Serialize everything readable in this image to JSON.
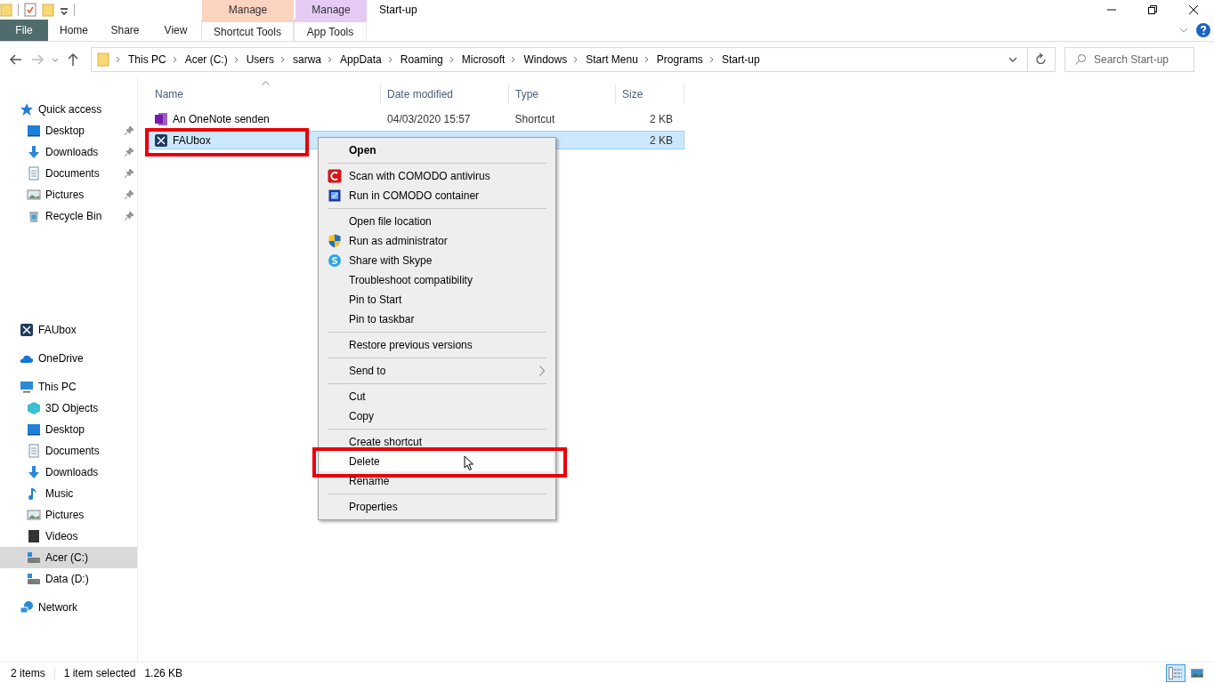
{
  "title_bar": {
    "context_groups": [
      {
        "label": "Manage",
        "color": "#fcd3bf"
      },
      {
        "label": "Manage",
        "color": "#e6cbf5"
      }
    ],
    "title": "Start-up"
  },
  "ribbon": {
    "tabs": [
      {
        "label": "File",
        "kind": "file"
      },
      {
        "label": "Home",
        "kind": "tab"
      },
      {
        "label": "Share",
        "kind": "tab"
      },
      {
        "label": "View",
        "kind": "tab"
      },
      {
        "label": "Shortcut Tools",
        "kind": "context"
      },
      {
        "label": "App Tools",
        "kind": "context"
      }
    ]
  },
  "address_bar": {
    "path": [
      "This PC",
      "Acer (C:)",
      "Users",
      "sarwa",
      "AppData",
      "Roaming",
      "Microsoft",
      "Windows",
      "Start Menu",
      "Programs",
      "Start-up"
    ]
  },
  "search": {
    "placeholder": "Search Start-up"
  },
  "navigation": [
    {
      "items": [
        {
          "label": "Quick access",
          "kind": "star",
          "selected": false,
          "children": [
            {
              "label": "Desktop",
              "kind": "desktop",
              "pinned": true,
              "selected": false
            },
            {
              "label": "Downloads",
              "kind": "downloads",
              "pinned": true,
              "selected": false
            },
            {
              "label": "Documents",
              "kind": "documents",
              "pinned": true,
              "selected": false
            },
            {
              "label": "Pictures",
              "kind": "pictures",
              "pinned": true,
              "selected": false
            },
            {
              "label": "Recycle Bin",
              "kind": "recycle",
              "pinned": true,
              "selected": false
            }
          ]
        }
      ]
    },
    {
      "items": [
        {
          "label": "FAUbox",
          "kind": "app",
          "selected": false
        }
      ]
    },
    {
      "items": [
        {
          "label": "OneDrive",
          "kind": "cloud",
          "selected": false
        }
      ]
    },
    {
      "items": [
        {
          "label": "This PC",
          "kind": "pc",
          "selected": false,
          "children": [
            {
              "label": "3D Objects",
              "kind": "cube",
              "selected": false
            },
            {
              "label": "Desktop",
              "kind": "desktop",
              "selected": false
            },
            {
              "label": "Documents",
              "kind": "documents",
              "selected": false
            },
            {
              "label": "Downloads",
              "kind": "downloads",
              "selected": false
            },
            {
              "label": "Music",
              "kind": "music",
              "selected": false
            },
            {
              "label": "Pictures",
              "kind": "pictures",
              "selected": false
            },
            {
              "label": "Videos",
              "kind": "videos",
              "selected": false
            },
            {
              "label": "Acer (C:)",
              "kind": "drive",
              "selected": true
            },
            {
              "label": "Data (D:)",
              "kind": "drive",
              "selected": false
            }
          ]
        }
      ]
    },
    {
      "items": [
        {
          "label": "Network",
          "kind": "network",
          "selected": false
        }
      ]
    }
  ],
  "file_list": {
    "columns": [
      "Name",
      "Date modified",
      "Type",
      "Size"
    ],
    "rows": [
      {
        "name": "An OneNote senden",
        "date": "04/03/2020 15:57",
        "type": "Shortcut",
        "size": "2 KB",
        "kind": "onenote",
        "selected": false,
        "highlighted": false
      },
      {
        "name": "FAUbox",
        "size": "2 KB",
        "kind": "app",
        "selected": true,
        "highlighted": true
      }
    ]
  },
  "context_menu": [
    {
      "label": "Open",
      "kind": "default",
      "highlighted": false,
      "hovered": false
    },
    {
      "kind": "separator"
    },
    {
      "label": "Scan with COMODO antivirus",
      "kind": "comodo",
      "highlighted": false,
      "hovered": false
    },
    {
      "label": "Run in COMODO container",
      "kind": "container",
      "highlighted": false,
      "hovered": false
    },
    {
      "kind": "separator"
    },
    {
      "label": "Open file location",
      "kind": "plain",
      "highlighted": false,
      "hovered": false
    },
    {
      "label": "Run as administrator",
      "kind": "shield",
      "highlighted": false,
      "hovered": false
    },
    {
      "label": "Share with Skype",
      "kind": "skype",
      "highlighted": false,
      "hovered": false
    },
    {
      "label": "Troubleshoot compatibility",
      "kind": "plain",
      "highlighted": false,
      "hovered": false
    },
    {
      "label": "Pin to Start",
      "kind": "plain",
      "highlighted": false,
      "hovered": false
    },
    {
      "label": "Pin to taskbar",
      "kind": "plain",
      "highlighted": false,
      "hovered": false
    },
    {
      "kind": "separator"
    },
    {
      "label": "Restore previous versions",
      "kind": "plain",
      "highlighted": false,
      "hovered": false
    },
    {
      "kind": "separator"
    },
    {
      "label": "Send to",
      "kind": "submenu",
      "highlighted": false,
      "hovered": false
    },
    {
      "kind": "separator"
    },
    {
      "label": "Cut",
      "kind": "plain",
      "highlighted": false,
      "hovered": false
    },
    {
      "label": "Copy",
      "kind": "plain",
      "highlighted": false,
      "hovered": false
    },
    {
      "kind": "separator"
    },
    {
      "label": "Create shortcut",
      "kind": "plain",
      "highlighted": false,
      "hovered": false
    },
    {
      "label": "Delete",
      "kind": "plain",
      "highlighted": true,
      "hovered": true
    },
    {
      "label": "Rename",
      "kind": "plain",
      "highlighted": false,
      "hovered": false
    },
    {
      "kind": "separator"
    },
    {
      "label": "Properties",
      "kind": "plain",
      "highlighted": false,
      "hovered": false
    }
  ],
  "status_bar": {
    "items": "2 items",
    "selection": "1 item selected",
    "size": "1.26 KB",
    "view_modes": [
      {
        "kind": "details",
        "selected": true
      },
      {
        "kind": "large-icons",
        "selected": false
      }
    ]
  }
}
